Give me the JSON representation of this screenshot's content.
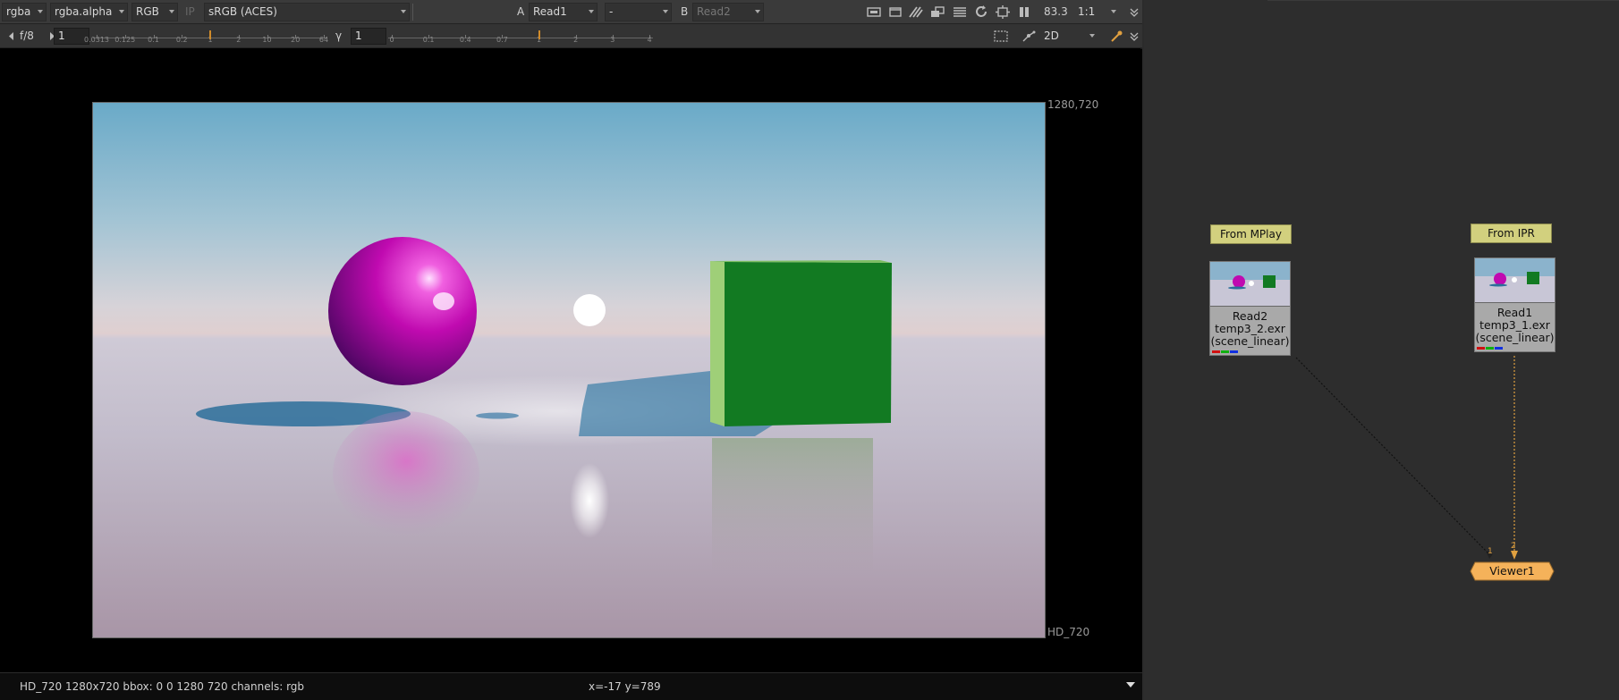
{
  "viewer": {
    "toolbar1": {
      "channels": "rgba",
      "alpha_channel": "rgba.alpha",
      "display_channel": "RGB",
      "ip_label": "IP",
      "colorspace": "sRGB (ACES)",
      "a_label": "A",
      "a_input": "Read1",
      "wipe_mode": "-",
      "b_label": "B",
      "b_input": "Read2",
      "zoom": "83.3",
      "proxy": "1:1"
    },
    "toolbar2": {
      "fstop": "f/8",
      "gain_value": "1",
      "gain_ticks": [
        "0.0313",
        "0.125",
        "0.1",
        "0.2",
        "1",
        "2",
        "10",
        "20",
        "64"
      ],
      "gamma_label": "γ",
      "gamma_value": "1",
      "gamma_ticks": [
        "0",
        "0.1",
        "0.4",
        "0.7",
        "1",
        "2",
        "3",
        "4"
      ],
      "view_mode": "2D"
    },
    "format_size": "1280,720",
    "format_name": "HD_720",
    "status": {
      "info": "HD_720 1280x720  bbox: 0 0 1280 720 channels: rgb",
      "coords": "x=-17 y=789"
    }
  },
  "node_graph": {
    "backdrops": [
      {
        "label": "From MPlay"
      },
      {
        "label": "From IPR"
      }
    ],
    "nodes": [
      {
        "name": "Read2",
        "file": "temp3_2.exr",
        "colorspace": "(scene_linear)"
      },
      {
        "name": "Read1",
        "file": "temp3_1.exr",
        "colorspace": "(scene_linear)"
      }
    ],
    "viewer_node": {
      "name": "Viewer1",
      "input1": "1",
      "input2": "2"
    },
    "colors": {
      "backdrop": "#d2d07e",
      "viewer": "#f5b25a",
      "pipe": "#e0a040"
    }
  }
}
